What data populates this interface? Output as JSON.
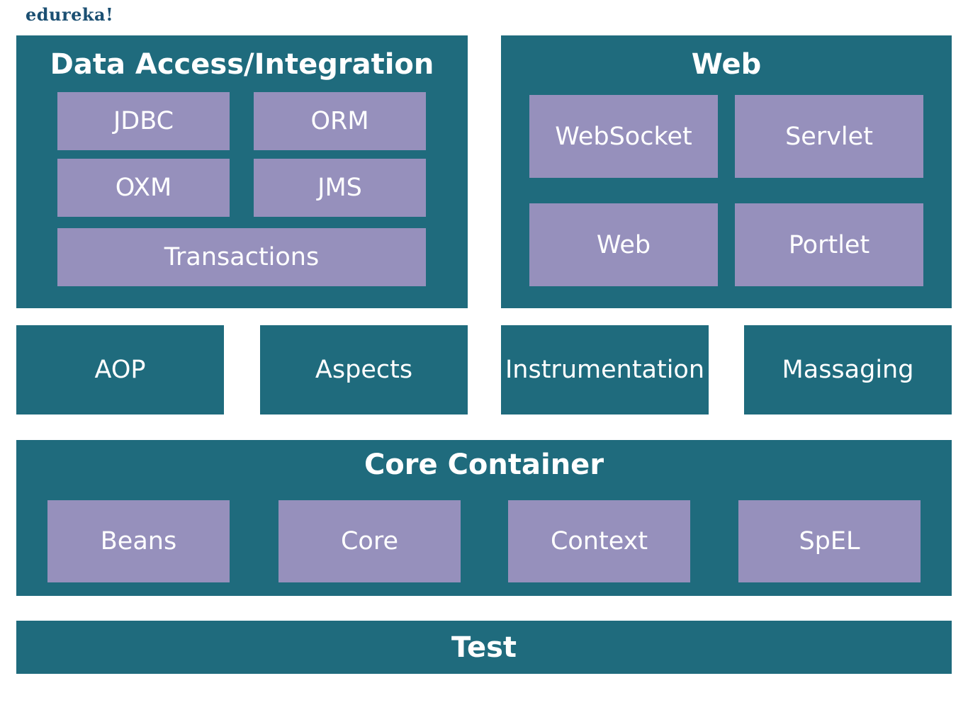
{
  "logo": "edureka!",
  "data_access": {
    "title": "Data Access/Integration",
    "items": [
      "JDBC",
      "ORM",
      "OXM",
      "JMS",
      "Transactions"
    ]
  },
  "web": {
    "title": "Web",
    "items": [
      "WebSocket",
      "Servlet",
      "Web",
      "Portlet"
    ]
  },
  "middle": [
    "AOP",
    "Aspects",
    "Instrumentation",
    "Massaging"
  ],
  "core": {
    "title": "Core Container",
    "items": [
      "Beans",
      "Core",
      "Context",
      "SpEL"
    ]
  },
  "test": "Test",
  "colors": {
    "module": "#1f6b7d",
    "submodule": "#9690bc",
    "logo": "#1b4f72"
  }
}
